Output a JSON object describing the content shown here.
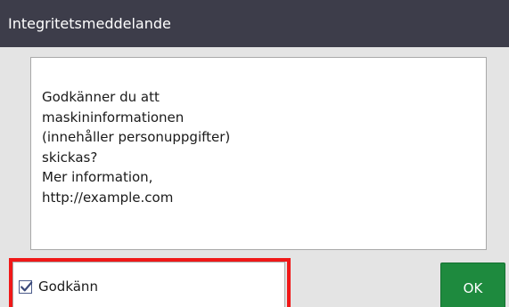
{
  "dialog": {
    "title": "Integritetsmeddelande",
    "message_lines": [
      "Godkänner du att",
      "maskininformationen",
      "(innehåller personuppgifter)",
      "skickas?",
      "Mer information,",
      "http://example.com"
    ],
    "agree_checkbox": {
      "label": "Godkänn",
      "checked": true
    },
    "ok_button_label": "OK"
  },
  "colors": {
    "titlebar": "#3d3d4a",
    "ok_button": "#1e8a3e",
    "highlight_frame": "#f01818",
    "checkbox_border": "#4a5a8a"
  },
  "icons": {
    "checkbox_check": "check-icon"
  }
}
